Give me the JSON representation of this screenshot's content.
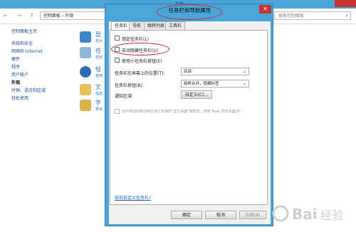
{
  "background_window": {
    "title": "外观",
    "breadcrumb": "控制面板 › 外观",
    "search_placeholder": "搜索控制面板",
    "nav_arrows": [
      "←",
      "→",
      "↑"
    ],
    "left_nav": [
      "控制面板主页",
      "系统和安全",
      "网络和 Internet",
      "硬件",
      "程序",
      "用户帐户",
      "外观",
      "时钟、语言和区域",
      "轻松使用"
    ],
    "active_nav_index": 6,
    "categories": [
      {
        "title": "显",
        "sub": "放大"
      },
      {
        "title": "任",
        "sub": "自定"
      },
      {
        "title": "轻",
        "sub": "使用"
      },
      {
        "title": "文",
        "sub": "指定"
      },
      {
        "title": "字",
        "sub": "预览"
      }
    ],
    "right_links": [
      "",
      "",
      "",
      ""
    ]
  },
  "dialog": {
    "title": "任务栏和导航属性",
    "close_glyph": "✕",
    "tabs": [
      "任务栏",
      "导航",
      "跳转列表",
      "工具栏"
    ],
    "active_tab": 0,
    "checkboxes": [
      {
        "label": "锁定任务栏(L)",
        "checked": false,
        "disabled": false
      },
      {
        "label": "自动隐藏任务栏(U)",
        "checked": false,
        "disabled": false
      },
      {
        "label": "使用小任务栏按钮(E)",
        "checked": false,
        "disabled": false
      }
    ],
    "location_label": "任务栏在屏幕上的位置(T):",
    "location_value": "底部",
    "buttons_label": "任务栏按钮(B):",
    "buttons_value": "始终合并，隐藏标签",
    "notify_label": "通知区域:",
    "customize_button": "自定义(C)...",
    "peek_label": "当你将鼠标移动到任务栏末端的\"显示桌面\"按钮时，使用 Peek 预览桌面(P)",
    "help_link": "如何自定义任务栏?",
    "ok": "确定",
    "cancel": "取消",
    "apply": "应用(A)"
  },
  "colors": {
    "titlebar": "#4aa6d8",
    "annotation": "#d4203a",
    "link": "#1c5cb8"
  }
}
